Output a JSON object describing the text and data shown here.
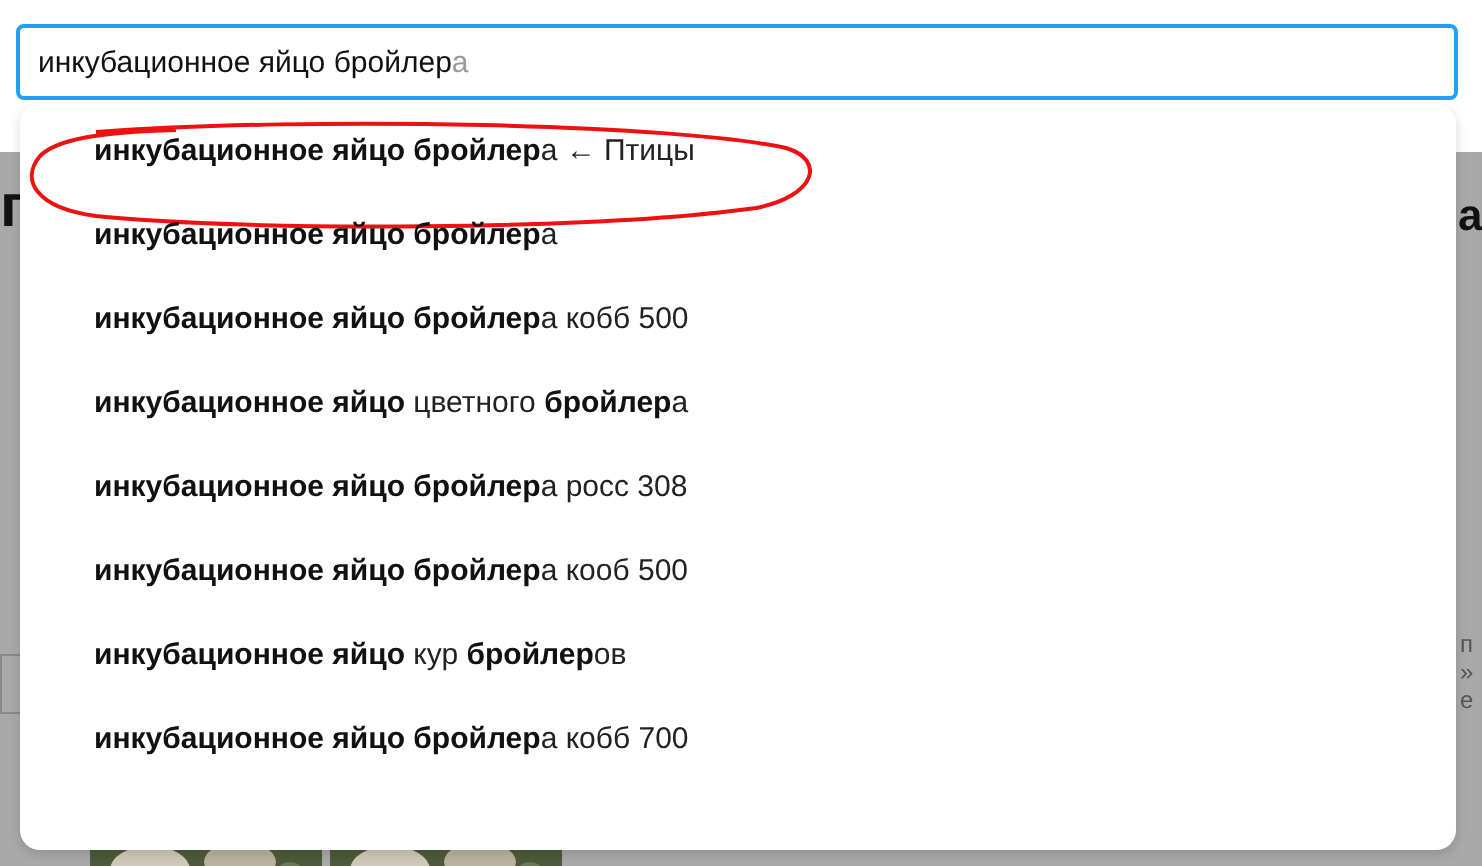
{
  "search": {
    "value": "инкубационное яйцо бройлер",
    "completion": "а"
  },
  "suggestions": [
    {
      "text": "**инкубационное яйцо бройлер**а ← Птицы",
      "highlighted": true
    },
    {
      "text": "**инкубационное яйцо бройлер**а",
      "highlighted": false
    },
    {
      "text": "**инкубационное яйцо бройлер**а кобб 500",
      "highlighted": false
    },
    {
      "text": "**инкубационное яйцо** цветного **бройлер**а",
      "highlighted": false
    },
    {
      "text": "**инкубационное яйцо бройлер**а росс 308",
      "highlighted": false
    },
    {
      "text": "**инкубационное яйцо бройлер**а кооб 500",
      "highlighted": false
    },
    {
      "text": "**инкубационное яйцо** кур **бройлер**ов",
      "highlighted": false
    },
    {
      "text": "**инкубационное яйцо бройлер**а кобб 700",
      "highlighted": false
    }
  ],
  "background": {
    "heading_left": "г",
    "heading_right": "а",
    "side_lines": [
      "п",
      "»",
      "е"
    ]
  }
}
